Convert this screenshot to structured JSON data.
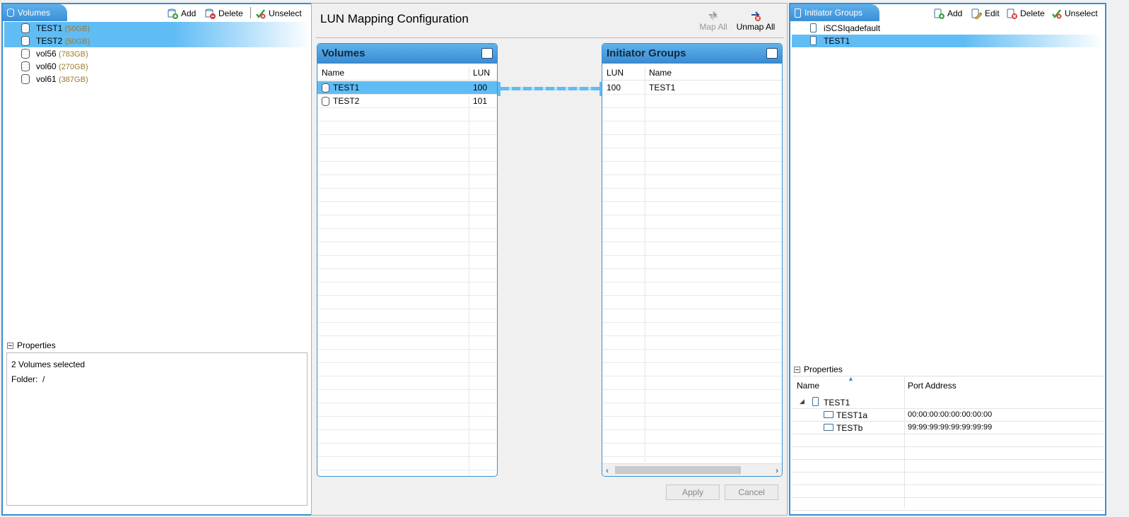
{
  "left_panel": {
    "tab_label": "Volumes",
    "toolbar": {
      "add": "Add",
      "delete": "Delete",
      "unselect": "Unselect"
    },
    "volumes": [
      {
        "name": "TEST1",
        "size": "(50GB)",
        "selected": true
      },
      {
        "name": "TEST2",
        "size": "(50GB)",
        "selected": true
      },
      {
        "name": "vol56",
        "size": "(783GB)",
        "selected": false
      },
      {
        "name": "vol60",
        "size": "(270GB)",
        "selected": false
      },
      {
        "name": "vol61",
        "size": "(387GB)",
        "selected": false
      }
    ],
    "properties": {
      "header": "Properties",
      "summary": "2 Volumes selected",
      "folder_label": "Folder:",
      "folder_value": "/"
    }
  },
  "center": {
    "title": "LUN Mapping Configuration",
    "map_all": "Map All",
    "unmap_all": "Unmap All",
    "volumes_card": {
      "title": "Volumes",
      "col_name": "Name",
      "col_lun": "LUN",
      "rows": [
        {
          "name": "TEST1",
          "lun": "100",
          "selected": true
        },
        {
          "name": "TEST2",
          "lun": "101",
          "selected": false
        }
      ]
    },
    "ig_card": {
      "title": "Initiator Groups",
      "col_lun": "LUN",
      "col_name": "Name",
      "rows": [
        {
          "lun": "100",
          "name": "TEST1"
        }
      ]
    },
    "apply": "Apply",
    "cancel": "Cancel"
  },
  "right_panel": {
    "tab_label": "Initiator Groups",
    "toolbar": {
      "add": "Add",
      "edit": "Edit",
      "delete": "Delete",
      "unselect": "Unselect"
    },
    "groups": [
      {
        "name": "iSCSIqadefault",
        "selected": false
      },
      {
        "name": "TEST1",
        "selected": true
      }
    ],
    "properties": {
      "header": "Properties",
      "col_name": "Name",
      "col_port": "Port Address",
      "group": "TEST1",
      "initiators": [
        {
          "name": "TEST1a",
          "port": "00:00:00:00:00:00:00:00"
        },
        {
          "name": "TESTb",
          "port": "99:99:99:99:99:99:99:99"
        }
      ]
    }
  }
}
